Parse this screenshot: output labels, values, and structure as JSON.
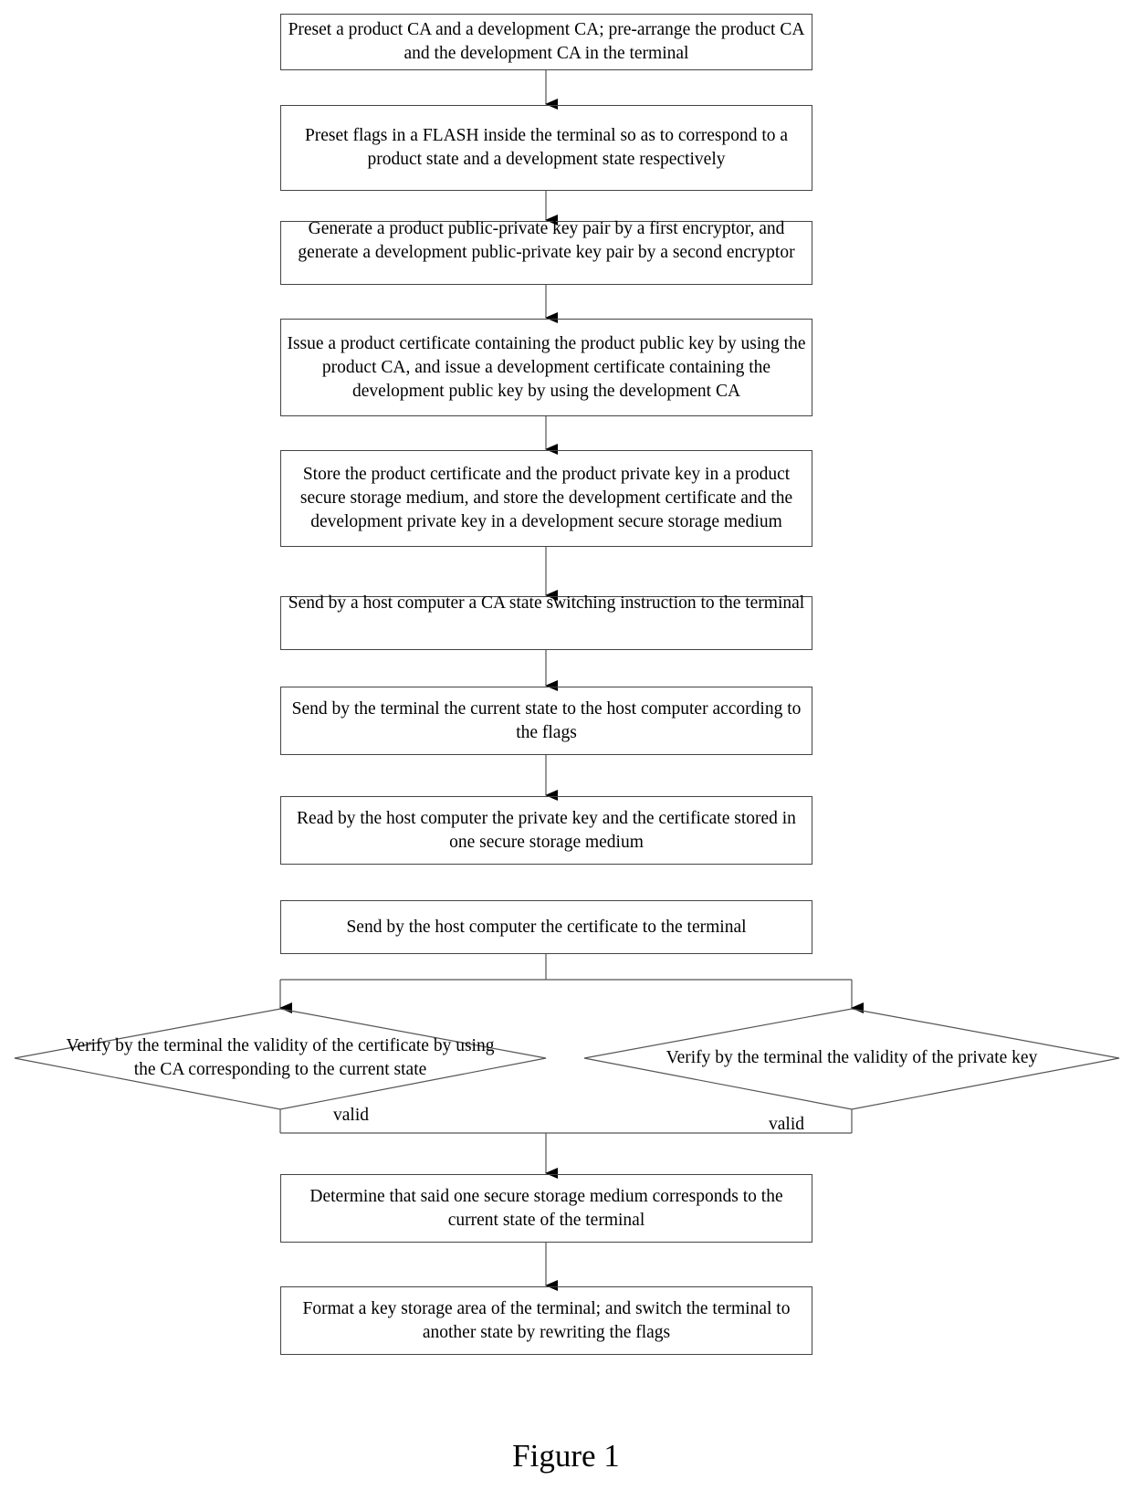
{
  "steps": [
    {
      "text": "Preset a product CA and a development CA; pre-arrange the product CA and the development CA in the terminal"
    },
    {
      "text": "Preset flags in a FLASH inside the terminal so as to correspond to a product state and a development state respectively"
    },
    {
      "text": "Generate a product public-private key pair by a first encryptor, and generate a development public-private key pair by a second encryptor"
    },
    {
      "text": "Issue a product certificate containing the product public key by using the product CA, and issue a development certificate containing the development public key by using the development CA"
    },
    {
      "text": "Store the product certificate and the product private key in a product secure storage medium, and store the development certificate and the development private key in a development secure storage medium"
    },
    {
      "text": "Send by a host computer a CA state switching instruction to the terminal"
    },
    {
      "text": "Send by the terminal the current state to the host computer according to the flags"
    },
    {
      "text": "Read by the host computer the private key and the certificate stored in one secure storage medium"
    },
    {
      "text": "Send by the host computer the certificate to the terminal"
    },
    {
      "text": "Determine that said one secure storage medium corresponds to the current state of the terminal"
    },
    {
      "text": "Format a key storage area of the terminal; and switch the terminal to another state by rewriting the flags"
    }
  ],
  "decisions": [
    {
      "text": "Verify by the terminal the validity of the certificate by using the CA corresponding to the current state",
      "branch_label": "valid"
    },
    {
      "text": "Verify by the terminal the validity of the private key",
      "branch_label": "valid"
    }
  ],
  "caption": "Figure 1"
}
